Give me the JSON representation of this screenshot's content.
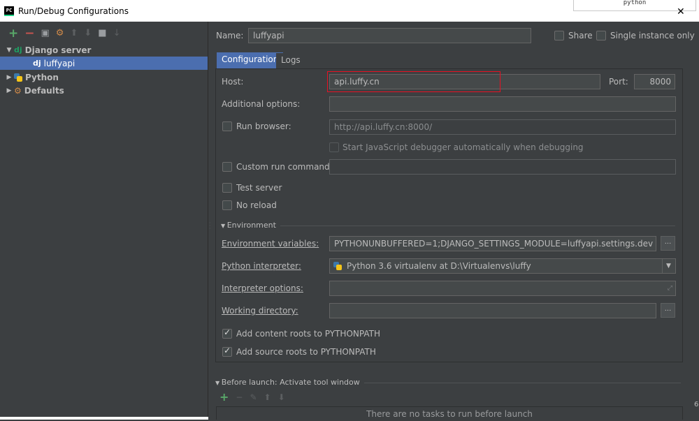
{
  "window": {
    "title": "Run/Debug Configurations",
    "app_icon": "PC",
    "overlay_text": "python",
    "close_icon": "close-icon"
  },
  "toolbar": {
    "icons": [
      "add-icon",
      "remove-icon",
      "copy-icon",
      "edit-defaults-icon",
      "move-up-icon",
      "move-down-icon",
      "folder-icon",
      "sort-icon"
    ]
  },
  "tree": {
    "items": [
      {
        "label": "Django server",
        "expanded": true,
        "icon": "django-icon"
      },
      {
        "label": "luffyapi",
        "selected": true,
        "icon": "django-icon",
        "icon_text": "dj"
      },
      {
        "label": "Python",
        "expanded": false,
        "icon": "python-icon"
      },
      {
        "label": "Defaults",
        "expanded": false,
        "icon": "defaults-icon"
      }
    ],
    "django_icon_text": "dj"
  },
  "header": {
    "name_label": "Name:",
    "name_value": "luffyapi",
    "share_label": "Share",
    "single_instance_label": "Single instance only"
  },
  "tabs": [
    {
      "label": "Configuration",
      "active": true
    },
    {
      "label": "Logs",
      "active": false
    }
  ],
  "config": {
    "host_label": "Host:",
    "host_value": "api.luffy.cn",
    "port_label": "Port:",
    "port_value": "8000",
    "additional_options_label": "Additional options:",
    "additional_options_value": "",
    "run_browser_label": "Run browser:",
    "run_browser_checked": false,
    "run_browser_url": "http://api.luffy.cn:8000/",
    "js_debugger_label": "Start JavaScript debugger automatically when debugging",
    "custom_run_label": "Custom run command:",
    "custom_run_value": "",
    "test_server_label": "Test server",
    "no_reload_label": "No reload",
    "environment_section": "Environment",
    "env_vars_label": "Environment variables:",
    "env_vars_value": "PYTHONUNBUFFERED=1;DJANGO_SETTINGS_MODULE=luffyapi.settings.dev",
    "interpreter_label": "Python interpreter:",
    "interpreter_value": "Python 3.6 virtualenv at D:\\Virtualenvs\\luffy",
    "interpreter_options_label": "Interpreter options:",
    "working_dir_label": "Working directory:",
    "content_roots_label": "Add content roots to PYTHONPATH",
    "source_roots_label": "Add source roots to PYTHONPATH",
    "browse_label": "..."
  },
  "before_launch": {
    "title": "Before launch: Activate tool window",
    "empty_text": "There are no tasks to run before launch"
  },
  "right_edge_text": "6",
  "colors": {
    "background": "#3c3f41",
    "selection": "#4b6eaf",
    "highlight_box": "#e81123",
    "add_green": "#59a869",
    "remove_red": "#c75450"
  }
}
